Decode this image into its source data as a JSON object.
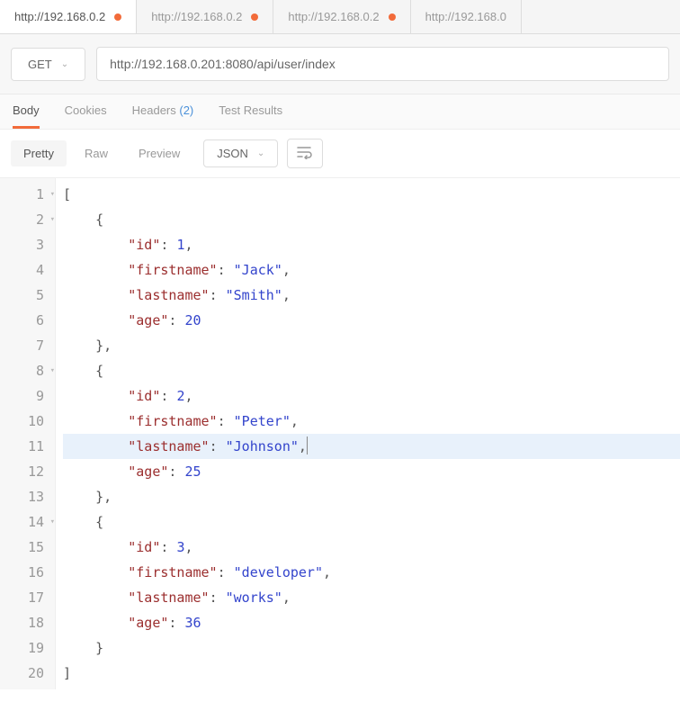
{
  "tabs": [
    {
      "label": "http://192.168.0.2",
      "unsaved": true,
      "active": true
    },
    {
      "label": "http://192.168.0.2",
      "unsaved": true,
      "active": false
    },
    {
      "label": "http://192.168.0.2",
      "unsaved": true,
      "active": false
    },
    {
      "label": "http://192.168.0",
      "unsaved": false,
      "active": false
    }
  ],
  "request": {
    "method": "GET",
    "url": "http://192.168.0.201:8080/api/user/index"
  },
  "response_tabs": {
    "body": "Body",
    "cookies": "Cookies",
    "headers": "Headers",
    "headers_count": "(2)",
    "test_results": "Test Results"
  },
  "view": {
    "pretty": "Pretty",
    "raw": "Raw",
    "preview": "Preview",
    "format": "JSON"
  },
  "highlight_line": 11,
  "code_lines": [
    {
      "n": 1,
      "fold": true,
      "tokens": [
        {
          "t": "[",
          "c": "p"
        }
      ]
    },
    {
      "n": 2,
      "fold": true,
      "tokens": [
        {
          "t": "    ",
          "c": ""
        },
        {
          "t": "{",
          "c": "p"
        }
      ]
    },
    {
      "n": 3,
      "tokens": [
        {
          "t": "        ",
          "c": ""
        },
        {
          "t": "\"id\"",
          "c": "k"
        },
        {
          "t": ": ",
          "c": "p"
        },
        {
          "t": "1",
          "c": "n"
        },
        {
          "t": ",",
          "c": "p"
        }
      ]
    },
    {
      "n": 4,
      "tokens": [
        {
          "t": "        ",
          "c": ""
        },
        {
          "t": "\"firstname\"",
          "c": "k"
        },
        {
          "t": ": ",
          "c": "p"
        },
        {
          "t": "\"Jack\"",
          "c": "s"
        },
        {
          "t": ",",
          "c": "p"
        }
      ]
    },
    {
      "n": 5,
      "tokens": [
        {
          "t": "        ",
          "c": ""
        },
        {
          "t": "\"lastname\"",
          "c": "k"
        },
        {
          "t": ": ",
          "c": "p"
        },
        {
          "t": "\"Smith\"",
          "c": "s"
        },
        {
          "t": ",",
          "c": "p"
        }
      ]
    },
    {
      "n": 6,
      "tokens": [
        {
          "t": "        ",
          "c": ""
        },
        {
          "t": "\"age\"",
          "c": "k"
        },
        {
          "t": ": ",
          "c": "p"
        },
        {
          "t": "20",
          "c": "n"
        }
      ]
    },
    {
      "n": 7,
      "tokens": [
        {
          "t": "    ",
          "c": ""
        },
        {
          "t": "},",
          "c": "p"
        }
      ]
    },
    {
      "n": 8,
      "fold": true,
      "tokens": [
        {
          "t": "    ",
          "c": ""
        },
        {
          "t": "{",
          "c": "p"
        }
      ]
    },
    {
      "n": 9,
      "tokens": [
        {
          "t": "        ",
          "c": ""
        },
        {
          "t": "\"id\"",
          "c": "k"
        },
        {
          "t": ": ",
          "c": "p"
        },
        {
          "t": "2",
          "c": "n"
        },
        {
          "t": ",",
          "c": "p"
        }
      ]
    },
    {
      "n": 10,
      "tokens": [
        {
          "t": "        ",
          "c": ""
        },
        {
          "t": "\"firstname\"",
          "c": "k"
        },
        {
          "t": ": ",
          "c": "p"
        },
        {
          "t": "\"Peter\"",
          "c": "s"
        },
        {
          "t": ",",
          "c": "p"
        }
      ]
    },
    {
      "n": 11,
      "tokens": [
        {
          "t": "        ",
          "c": ""
        },
        {
          "t": "\"lastname\"",
          "c": "k"
        },
        {
          "t": ": ",
          "c": "p"
        },
        {
          "t": "\"Johnson\"",
          "c": "s"
        },
        {
          "t": ",",
          "c": "p"
        }
      ],
      "cursor": true
    },
    {
      "n": 12,
      "tokens": [
        {
          "t": "        ",
          "c": ""
        },
        {
          "t": "\"age\"",
          "c": "k"
        },
        {
          "t": ": ",
          "c": "p"
        },
        {
          "t": "25",
          "c": "n"
        }
      ]
    },
    {
      "n": 13,
      "tokens": [
        {
          "t": "    ",
          "c": ""
        },
        {
          "t": "},",
          "c": "p"
        }
      ]
    },
    {
      "n": 14,
      "fold": true,
      "tokens": [
        {
          "t": "    ",
          "c": ""
        },
        {
          "t": "{",
          "c": "p"
        }
      ]
    },
    {
      "n": 15,
      "tokens": [
        {
          "t": "        ",
          "c": ""
        },
        {
          "t": "\"id\"",
          "c": "k"
        },
        {
          "t": ": ",
          "c": "p"
        },
        {
          "t": "3",
          "c": "n"
        },
        {
          "t": ",",
          "c": "p"
        }
      ]
    },
    {
      "n": 16,
      "tokens": [
        {
          "t": "        ",
          "c": ""
        },
        {
          "t": "\"firstname\"",
          "c": "k"
        },
        {
          "t": ": ",
          "c": "p"
        },
        {
          "t": "\"developer\"",
          "c": "s"
        },
        {
          "t": ",",
          "c": "p"
        }
      ]
    },
    {
      "n": 17,
      "tokens": [
        {
          "t": "        ",
          "c": ""
        },
        {
          "t": "\"lastname\"",
          "c": "k"
        },
        {
          "t": ": ",
          "c": "p"
        },
        {
          "t": "\"works\"",
          "c": "s"
        },
        {
          "t": ",",
          "c": "p"
        }
      ]
    },
    {
      "n": 18,
      "tokens": [
        {
          "t": "        ",
          "c": ""
        },
        {
          "t": "\"age\"",
          "c": "k"
        },
        {
          "t": ": ",
          "c": "p"
        },
        {
          "t": "36",
          "c": "n"
        }
      ]
    },
    {
      "n": 19,
      "tokens": [
        {
          "t": "    ",
          "c": ""
        },
        {
          "t": "}",
          "c": "p"
        }
      ]
    },
    {
      "n": 20,
      "tokens": [
        {
          "t": "]",
          "c": "p"
        }
      ]
    }
  ]
}
